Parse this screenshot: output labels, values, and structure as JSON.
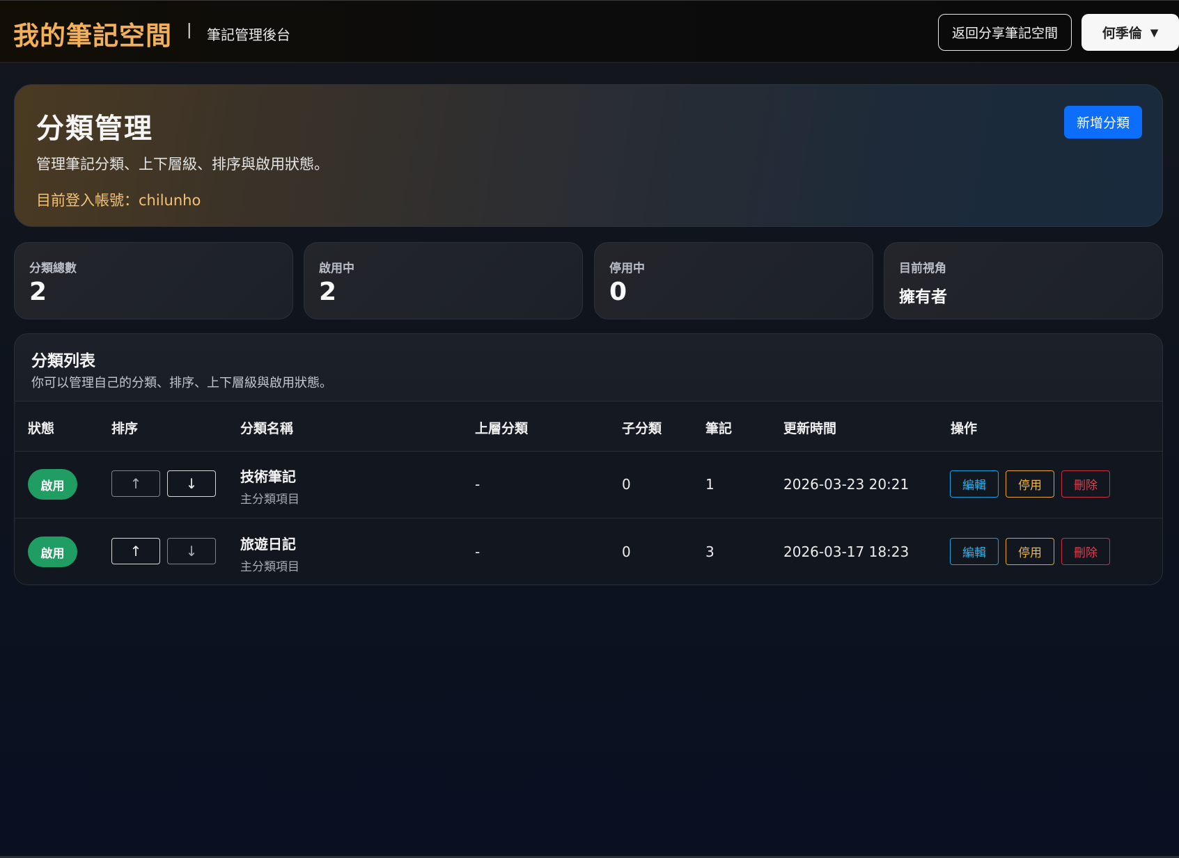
{
  "nav": {
    "brand": "我的筆記空間",
    "separator": "|",
    "subtitle": "筆記管理後台",
    "back_label": "返回分享筆記空間",
    "user_label": "何季倫",
    "user_caret": "▼"
  },
  "hero": {
    "title": "分類管理",
    "description": "管理筆記分類、上下層級、排序與啟用狀態。",
    "account": "目前登入帳號：chilunho",
    "new_button": "新增分類"
  },
  "stats": [
    {
      "label": "分類總數",
      "value": "2"
    },
    {
      "label": "啟用中",
      "value": "2"
    },
    {
      "label": "停用中",
      "value": "0"
    },
    {
      "label": "目前視角",
      "value": "擁有者"
    }
  ],
  "list": {
    "title": "分類列表",
    "subtitle": "你可以管理自己的分類、排序、上下層級與啟用狀態。",
    "headers": {
      "status": "狀態",
      "order": "排序",
      "name": "分類名稱",
      "parent": "上層分類",
      "children": "子分類",
      "notes": "筆記",
      "updated": "更新時間",
      "actions": "操作"
    },
    "rows": [
      {
        "status": "啟用",
        "up": "↑",
        "down": "↓",
        "name": "技術筆記",
        "type": "主分類項目",
        "parent": "-",
        "children": "0",
        "notes": "1",
        "updated": "2026-03-23 20:21",
        "edit": "編輯",
        "disable": "停用",
        "delete": "刪除"
      },
      {
        "status": "啟用",
        "up": "↑",
        "down": "↓",
        "name": "旅遊日記",
        "type": "主分類項目",
        "parent": "-",
        "children": "0",
        "notes": "3",
        "updated": "2026-03-17 18:23",
        "edit": "編輯",
        "disable": "停用",
        "delete": "刪除"
      }
    ]
  },
  "colors": {
    "brand": "#f2b05a",
    "primary": "#0d6efd",
    "success": "#1f9d63",
    "info": "#27b3ea",
    "warning": "#f0b63a",
    "danger": "#d8414e"
  }
}
